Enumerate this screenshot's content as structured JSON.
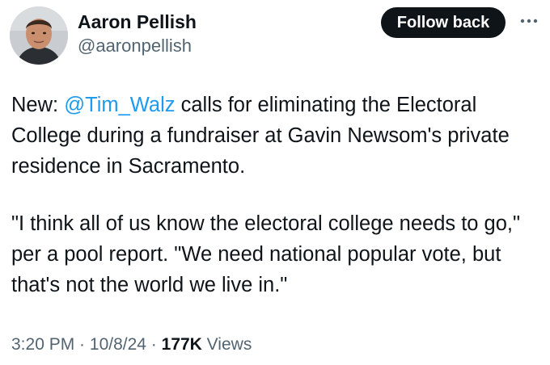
{
  "author": {
    "display_name": "Aaron Pellish",
    "handle": "@aaronpellish",
    "avatar_icon": "profile-photo"
  },
  "actions": {
    "follow_label": "Follow back",
    "more_icon": "more-horizontal-icon"
  },
  "tweet": {
    "para1_prefix": "New: ",
    "mention": "@Tim_Walz",
    "para1_suffix": " calls for eliminating the Electoral College during a fundraiser at Gavin Newsom's private residence in Sacramento.",
    "para2": "\"I think all of us know the electoral college needs to go,\" per a pool report. \"We need national popular vote, but that's not the world we live in.\""
  },
  "meta": {
    "time": "3:20 PM",
    "separator": " · ",
    "date": "10/8/24",
    "views_count": "177K",
    "views_label": " Views"
  },
  "colors": {
    "text": "#0f1419",
    "secondary": "#536471",
    "link": "#1d9bf0",
    "button_bg": "#0f1419"
  }
}
